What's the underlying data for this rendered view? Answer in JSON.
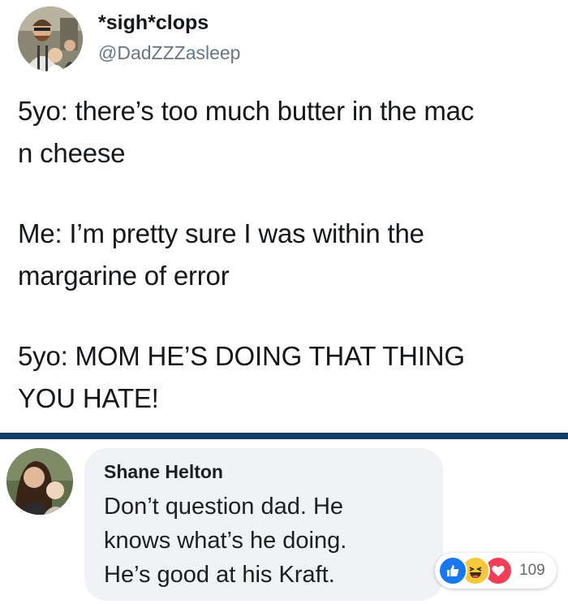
{
  "tweet": {
    "display_name": "*sigh*clops",
    "handle": "@DadZZZasleep",
    "lines": [
      "5yo: there’s too much butter in the mac",
      "n cheese",
      "Me: I’m pretty sure I was within the",
      "margarine of error",
      "5yo: MOM HE’S DOING THAT THING",
      "YOU HATE!"
    ]
  },
  "comment": {
    "author": "Shane Helton",
    "lines": [
      "Don’t question dad. He",
      "knows what’s he doing.",
      "He’s good at his Kraft."
    ],
    "reactions": {
      "icons": [
        "like-icon",
        "haha-icon",
        "love-icon"
      ],
      "count": "109"
    }
  },
  "colors": {
    "divider": "#123a66",
    "bubble": "#f0f2f5",
    "like": "#1877f2",
    "haha": "#f7c93a",
    "love": "#f33e58",
    "handle": "#657786"
  }
}
